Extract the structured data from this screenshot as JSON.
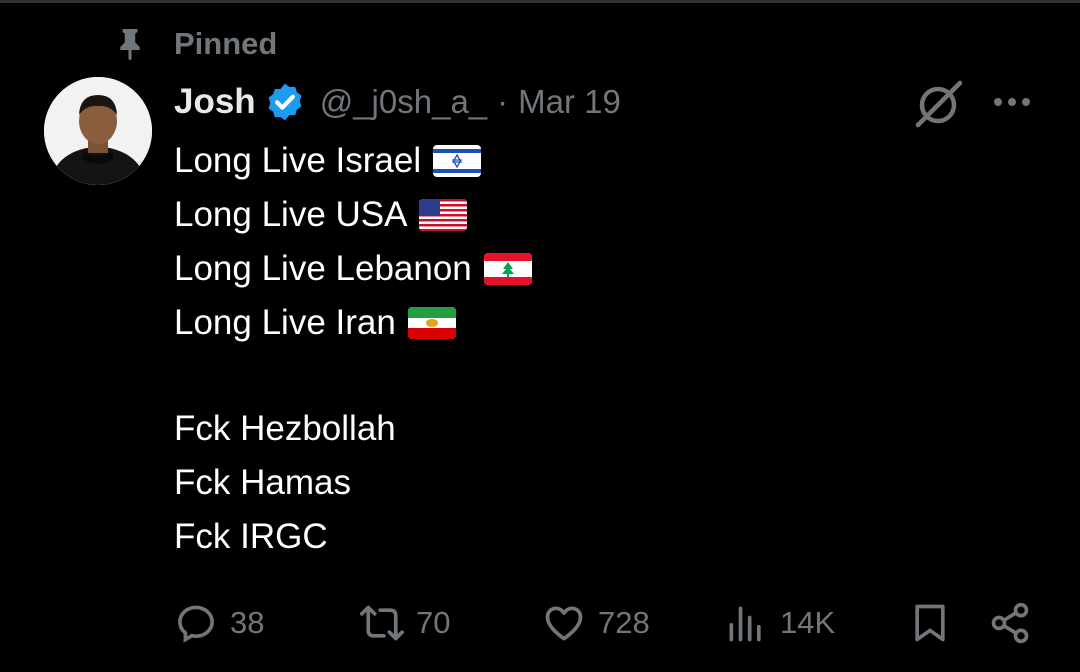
{
  "pinned": {
    "label": "Pinned"
  },
  "tweet": {
    "author": {
      "display_name": "Josh",
      "handle": "@_j0sh_a_",
      "separator": "·",
      "date": "Mar 19"
    },
    "lines": [
      {
        "text": "Long Live Israel",
        "flag": "israel-flag"
      },
      {
        "text": "Long Live USA",
        "flag": "usa-flag"
      },
      {
        "text": "Long Live Lebanon",
        "flag": "lebanon-flag"
      },
      {
        "text": "Long Live Iran",
        "flag": "iran-lion-sun-flag"
      },
      {
        "text": "Fck Hezbollah"
      },
      {
        "text": "Fck Hamas"
      },
      {
        "text": "Fck IRGC"
      }
    ]
  },
  "actions": {
    "replies": "38",
    "reposts": "70",
    "likes": "728",
    "views": "14K"
  },
  "icons": {
    "pin": "pin-icon",
    "verified": "verified-badge-icon",
    "grok": "grok-icon",
    "more": "more-icon",
    "reply": "reply-icon",
    "repost": "repost-icon",
    "like": "heart-icon",
    "views": "views-icon",
    "bookmark": "bookmark-icon",
    "share": "share-icon"
  },
  "colors": {
    "background": "#000000",
    "text": "#ffffff",
    "muted": "#71767b",
    "verified": "#1d9bf0"
  }
}
